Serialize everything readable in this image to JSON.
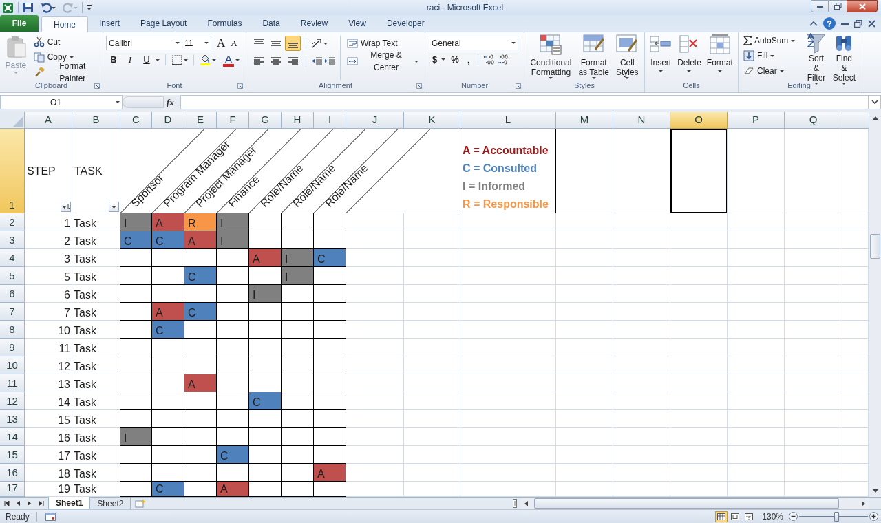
{
  "window": {
    "title": "raci  -  Microsoft Excel"
  },
  "ribbon_tabs": [
    {
      "label": "File",
      "kind": "file",
      "selected": false
    },
    {
      "label": "Home",
      "kind": "tab",
      "selected": true
    },
    {
      "label": "Insert",
      "kind": "tab",
      "selected": false
    },
    {
      "label": "Page Layout",
      "kind": "tab",
      "selected": false
    },
    {
      "label": "Formulas",
      "kind": "tab",
      "selected": false
    },
    {
      "label": "Data",
      "kind": "tab",
      "selected": false
    },
    {
      "label": "Review",
      "kind": "tab",
      "selected": false
    },
    {
      "label": "View",
      "kind": "tab",
      "selected": false
    },
    {
      "label": "Developer",
      "kind": "tab",
      "selected": false
    }
  ],
  "help": "?",
  "clipboard": {
    "label": "Clipboard",
    "paste": "Paste",
    "cut": "Cut",
    "copy": "Copy",
    "format_painter": "Format Painter"
  },
  "font": {
    "label": "Font",
    "name": "Calibri",
    "size": "11",
    "grow": "A",
    "shrink": "A",
    "styles": [
      "B",
      "I",
      "U"
    ],
    "color_letter": "A"
  },
  "alignment": {
    "label": "Alignment",
    "wrap": "Wrap Text",
    "merge": "Merge & Center",
    "vertical": [
      {
        "selected": false
      },
      {
        "selected": false
      },
      {
        "selected": true
      }
    ],
    "horizontal": [
      {
        "selected": false
      },
      {
        "selected": false
      },
      {
        "selected": false
      }
    ]
  },
  "number": {
    "label": "Number",
    "format": "General",
    "currency": "$",
    "percent": "%",
    "comma": ","
  },
  "styles": {
    "label": "Styles",
    "buttons": [
      {
        "lines": [
          "Conditional",
          "Formatting"
        ]
      },
      {
        "lines": [
          "Format",
          "as Table"
        ]
      },
      {
        "lines": [
          "Cell",
          "Styles"
        ]
      }
    ]
  },
  "cells": {
    "label": "Cells",
    "buttons": [
      "Insert",
      "Delete",
      "Format"
    ]
  },
  "editing": {
    "label": "Editing",
    "autosum": "AutoSum",
    "fill": "Fill",
    "clear": "Clear",
    "sort": [
      "Sort &",
      "Filter"
    ],
    "find": [
      "Find &",
      "Select"
    ]
  },
  "formula_bar": {
    "name_box": "O1",
    "function": "fx"
  },
  "columns": [
    {
      "label": "A",
      "selected": false
    },
    {
      "label": "B",
      "selected": false
    },
    {
      "label": "C",
      "selected": false
    },
    {
      "label": "D",
      "selected": false
    },
    {
      "label": "E",
      "selected": false
    },
    {
      "label": "F",
      "selected": false
    },
    {
      "label": "G",
      "selected": false
    },
    {
      "label": "H",
      "selected": false
    },
    {
      "label": "I",
      "selected": false
    },
    {
      "label": "J",
      "selected": false
    },
    {
      "label": "K",
      "selected": false
    },
    {
      "label": "L",
      "selected": false
    },
    {
      "label": "M",
      "selected": false
    },
    {
      "label": "N",
      "selected": false
    },
    {
      "label": "O",
      "selected": true
    },
    {
      "label": "P",
      "selected": false
    },
    {
      "label": "Q",
      "selected": false
    }
  ],
  "header_row": {
    "row": "1",
    "selected": true,
    "step": "STEP",
    "task": "TASK",
    "roles": [
      "Sponsor",
      "Program Manager",
      "Project Manager",
      "Finance",
      "Role/Name",
      "Role/Name",
      "Role/Name"
    ],
    "legend": [
      {
        "text": "A = Accountable",
        "color": "#9c1c1c"
      },
      {
        "text": "C = Consulted",
        "color": "#4f81bd"
      },
      {
        "text": "I = Informed",
        "color": "#7f7f7f"
      },
      {
        "text": "R = Responsible",
        "color": "#f79646"
      }
    ]
  },
  "rows": [
    {
      "row": "2",
      "step": "1",
      "task": "Task",
      "cells": [
        {
          "text": "I",
          "color": "#808080"
        },
        {
          "text": "A",
          "color": "#c0504d"
        },
        {
          "text": "R",
          "color": "#f79646"
        },
        {
          "text": "I",
          "color": "#808080"
        },
        null,
        null,
        null
      ]
    },
    {
      "row": "3",
      "step": "2",
      "task": "Task",
      "cells": [
        {
          "text": "C",
          "color": "#4f81bd"
        },
        {
          "text": "C",
          "color": "#4f81bd"
        },
        {
          "text": "A",
          "color": "#c0504d"
        },
        {
          "text": "I",
          "color": "#808080"
        },
        null,
        null,
        null
      ]
    },
    {
      "row": "4",
      "step": "3",
      "task": "Task",
      "cells": [
        null,
        null,
        null,
        null,
        {
          "text": "A",
          "color": "#c0504d"
        },
        {
          "text": "I",
          "color": "#808080"
        },
        {
          "text": "C",
          "color": "#4f81bd"
        }
      ]
    },
    {
      "row": "5",
      "step": "5",
      "task": "Task",
      "cells": [
        null,
        null,
        {
          "text": "C",
          "color": "#4f81bd"
        },
        null,
        null,
        {
          "text": "I",
          "color": "#808080"
        },
        null
      ]
    },
    {
      "row": "6",
      "step": "6",
      "task": "Task",
      "cells": [
        null,
        null,
        null,
        null,
        {
          "text": "I",
          "color": "#808080"
        },
        null,
        null
      ]
    },
    {
      "row": "7",
      "step": "7",
      "task": "Task",
      "cells": [
        null,
        {
          "text": "A",
          "color": "#c0504d"
        },
        {
          "text": "C",
          "color": "#4f81bd"
        },
        null,
        null,
        null,
        null
      ]
    },
    {
      "row": "8",
      "step": "10",
      "task": "Task",
      "cells": [
        null,
        {
          "text": "C",
          "color": "#4f81bd"
        },
        null,
        null,
        null,
        null,
        null
      ]
    },
    {
      "row": "9",
      "step": "11",
      "task": "Task",
      "cells": [
        null,
        null,
        null,
        null,
        null,
        null,
        null
      ]
    },
    {
      "row": "10",
      "step": "12",
      "task": "Task",
      "cells": [
        null,
        null,
        null,
        null,
        null,
        null,
        null
      ]
    },
    {
      "row": "11",
      "step": "13",
      "task": "Task",
      "cells": [
        null,
        null,
        {
          "text": "A",
          "color": "#c0504d"
        },
        null,
        null,
        null,
        null
      ]
    },
    {
      "row": "12",
      "step": "14",
      "task": "Task",
      "cells": [
        null,
        null,
        null,
        null,
        {
          "text": "C",
          "color": "#4f81bd"
        },
        null,
        null
      ]
    },
    {
      "row": "13",
      "step": "15",
      "task": "Task",
      "cells": [
        null,
        null,
        null,
        null,
        null,
        null,
        null
      ]
    },
    {
      "row": "14",
      "step": "16",
      "task": "Task",
      "cells": [
        {
          "text": "I",
          "color": "#808080"
        },
        null,
        null,
        null,
        null,
        null,
        null
      ]
    },
    {
      "row": "15",
      "step": "17",
      "task": "Task",
      "cells": [
        null,
        null,
        null,
        {
          "text": "C",
          "color": "#4f81bd"
        },
        null,
        null,
        null
      ]
    },
    {
      "row": "16",
      "step": "18",
      "task": "Task",
      "cells": [
        null,
        null,
        null,
        null,
        null,
        null,
        {
          "text": "A",
          "color": "#c0504d"
        }
      ]
    },
    {
      "row": "17",
      "step": "19",
      "task": "Task",
      "cells": [
        null,
        {
          "text": "C",
          "color": "#4f81bd"
        },
        null,
        {
          "text": "A",
          "color": "#c0504d"
        },
        null,
        null,
        null
      ]
    }
  ],
  "sheet_tabs": [
    {
      "label": "Sheet1",
      "selected": true
    },
    {
      "label": "Sheet2",
      "selected": false
    }
  ],
  "status_bar": {
    "text": "Ready",
    "zoom": "130%",
    "zoom_slider": {
      "level": 0.54
    }
  }
}
